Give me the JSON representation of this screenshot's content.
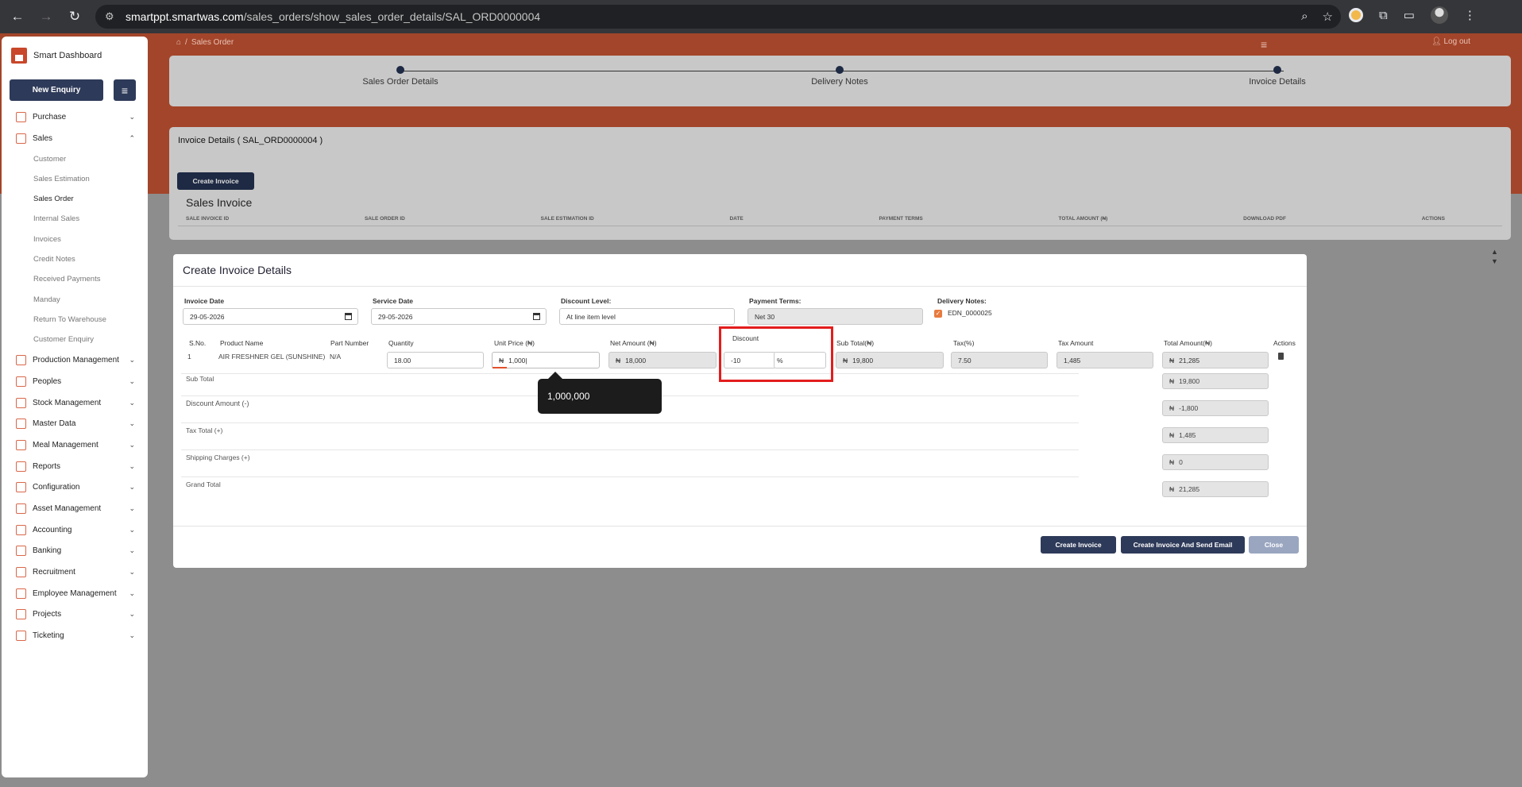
{
  "browser": {
    "url_host": "smartppt.smartwas.com",
    "url_path": "/sales_orders/show_sales_order_details/SAL_ORD0000004"
  },
  "sidebar": {
    "brand": "Smart Dashboard",
    "new_enquiry": "New Enquiry",
    "items": [
      {
        "label": "Purchase",
        "chev": "⌄"
      },
      {
        "label": "Sales",
        "chev": "⌃"
      }
    ],
    "sales_sub": [
      "Customer",
      "Sales Estimation",
      "Sales Order",
      "Internal Sales",
      "Invoices",
      "Credit Notes",
      "Received Payments",
      "Manday",
      "Return To Warehouse",
      "Customer Enquiry"
    ],
    "more_items": [
      "Production Management",
      "Peoples",
      "Stock Management",
      "Master Data",
      "Meal Management",
      "Reports",
      "Configuration",
      "Asset Management",
      "Accounting",
      "Banking",
      "Recruitment",
      "Employee Management",
      "Projects",
      "Ticketing"
    ]
  },
  "topbar": {
    "breadcrumb_sep": "/",
    "breadcrumb": "Sales Order",
    "logout": "Log out"
  },
  "stepper": {
    "steps": [
      "Sales Order Details",
      "Delivery Notes",
      "Invoice Details"
    ]
  },
  "invoice_card": {
    "title": "Invoice Details ( SAL_ORD0000004 )",
    "create_button": "Create Invoice",
    "section_title": "Sales Invoice",
    "columns": [
      "SALE INVOICE ID",
      "SALE ORDER ID",
      "SALE ESTIMATION ID",
      "DATE",
      "PAYMENT TERMS",
      "TOTAL AMOUNT (₦)",
      "DOWNLOAD PDF",
      "ACTIONS"
    ]
  },
  "modal": {
    "title": "Create Invoice Details",
    "invoice_date_label": "Invoice Date",
    "invoice_date": "29-05-2026",
    "service_date_label": "Service Date",
    "service_date": "29-05-2026",
    "discount_level_label": "Discount Level:",
    "discount_level": "At line item level",
    "payment_terms_label": "Payment Terms:",
    "payment_terms": "Net 30",
    "delivery_notes_label": "Delivery Notes:",
    "delivery_note": "EDN_0000025",
    "table_headers": {
      "sno": "S.No.",
      "product": "Product Name",
      "part": "Part Number",
      "quantity": "Quantity",
      "unit_price": "Unit Price (₦)",
      "net_amount": "Net Amount (₦)",
      "discount": "Discount",
      "sub_total": "Sub Total(₦)",
      "tax": "Tax(%)",
      "tax_amount": "Tax Amount",
      "total_amount": "Total Amount(₦)",
      "actions": "Actions"
    },
    "row": {
      "sno": "1",
      "product": "AIR FRESHNER GEL (SUNSHINE)",
      "part": "N/A",
      "quantity": "18.00",
      "unit_price": "1,000",
      "net_amount": "18,000",
      "discount_value": "-10",
      "discount_unit": "%",
      "sub_total": "19,800",
      "tax": "7.50",
      "tax_amount": "1,485",
      "total_amount": "21,285"
    },
    "currency": "₦",
    "tooltip": "1,000,000",
    "summary": [
      {
        "label": "Sub Total",
        "value": "19,800"
      },
      {
        "label": "Discount Amount (-)",
        "value": "-1,800"
      },
      {
        "label": "Tax Total (+)",
        "value": "1,485"
      },
      {
        "label": "Shipping Charges (+)",
        "value": "0"
      },
      {
        "label": "Grand Total",
        "value": "21,285"
      }
    ],
    "buttons": {
      "create": "Create Invoice",
      "create_email": "Create Invoice And Send Email",
      "close": "Close"
    }
  }
}
